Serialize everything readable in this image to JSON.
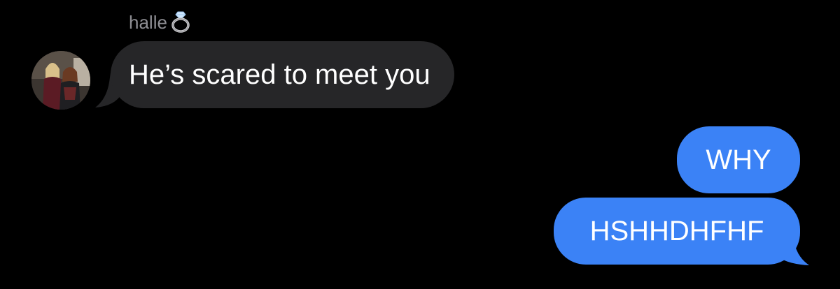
{
  "conversation": {
    "sender": {
      "name": "halle",
      "name_emoji_icon": "ring-icon",
      "avatar_icon": "contact-photo"
    },
    "messages": [
      {
        "direction": "incoming",
        "text": "He’s scared to meet you"
      },
      {
        "direction": "outgoing",
        "text": "WHY"
      },
      {
        "direction": "outgoing",
        "text": "HSHHDHFHF"
      }
    ]
  },
  "colors": {
    "background": "#000000",
    "incoming_bubble": "#262628",
    "outgoing_bubble": "#3b82f6",
    "sender_name": "#8e8e93"
  }
}
